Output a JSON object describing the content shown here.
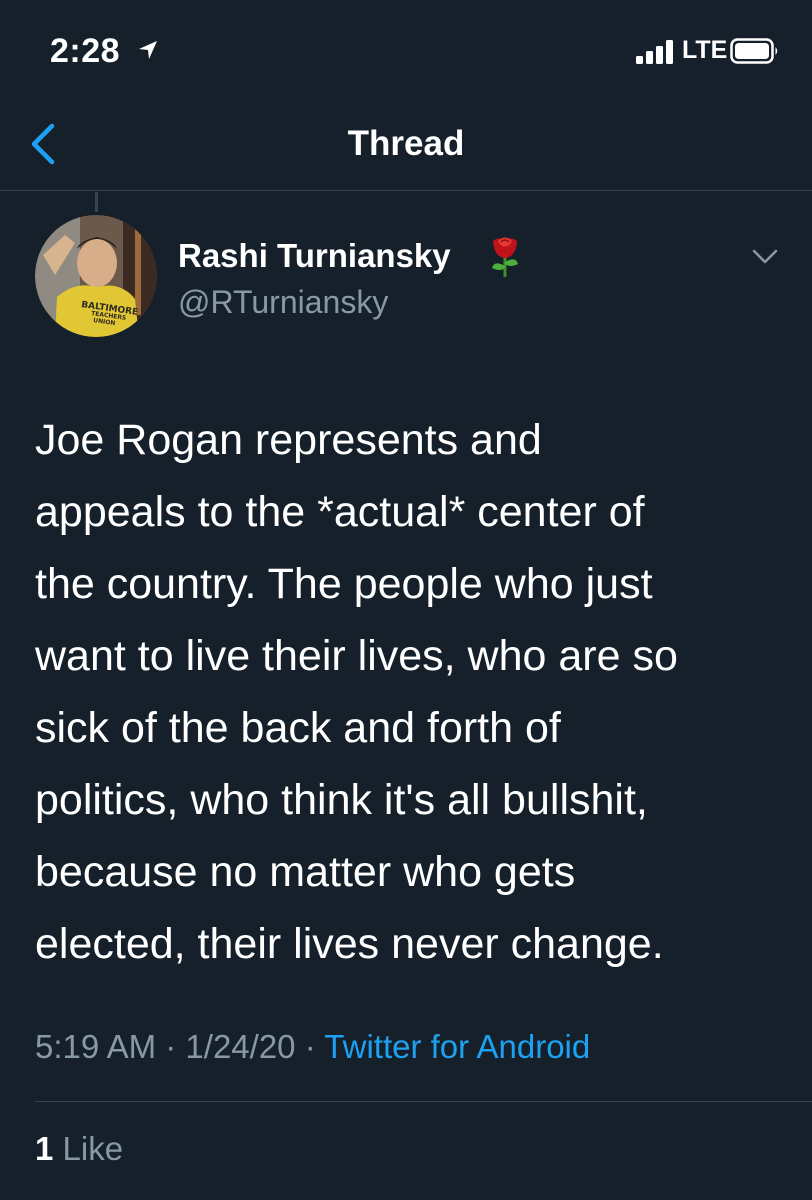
{
  "status_bar": {
    "time": "2:28",
    "location_icon": "location-arrow-icon",
    "signal_icon": "cellular-signal-icon",
    "network": "LTE",
    "battery_icon": "battery-icon"
  },
  "header": {
    "back_icon": "chevron-left-icon",
    "title": "Thread"
  },
  "tweet": {
    "author_name": "Rashi Turniansky",
    "author_emoji_icon": "rose-icon",
    "handle": "@RTurniansky",
    "avatar_icon": "profile-avatar",
    "more_icon": "chevron-down-icon",
    "text_lines": [
      "Joe Rogan represents and",
      "appeals to the *actual* center of",
      "the country. The people who just",
      "want to live their lives, who are so",
      "sick of the back and forth of",
      "politics, who think it's all bullshit,",
      "because no matter who gets",
      "elected, their lives never change."
    ],
    "time": "5:19 AM",
    "date": "1/24/20",
    "separator": "·",
    "source": "Twitter for Android",
    "likes_count": "1",
    "likes_label": "Like"
  },
  "colors": {
    "background": "#15202b",
    "text": "#ffffff",
    "secondary_text": "#8899a6",
    "accent": "#1da1f2",
    "divider": "#38444d"
  }
}
